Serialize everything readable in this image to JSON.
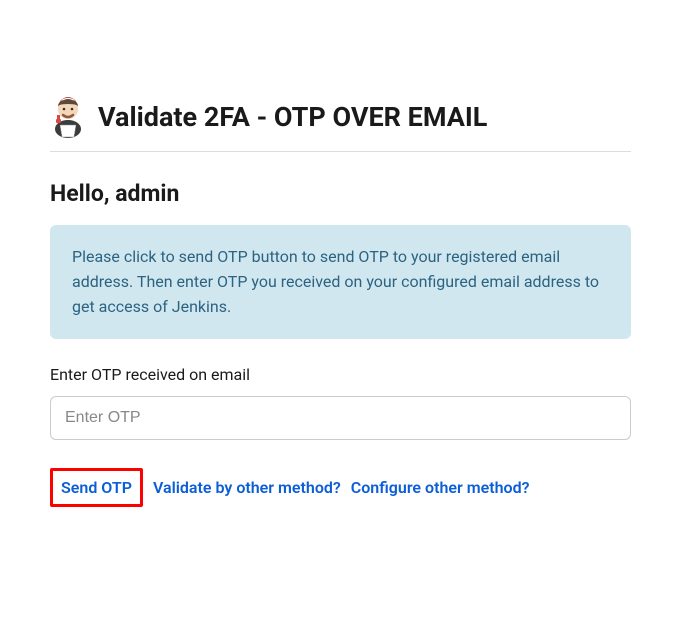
{
  "header": {
    "title": "Validate 2FA - OTP OVER EMAIL"
  },
  "greeting": "Hello, admin",
  "info_message": "Please click to send OTP button to send OTP to your registered email address. Then enter OTP you received on your configured email address to get access of Jenkins.",
  "form": {
    "otp_label": "Enter OTP received on email",
    "otp_placeholder": "Enter OTP"
  },
  "actions": {
    "send_otp": "Send OTP",
    "validate_other": "Validate by other method?",
    "configure_other": "Configure other method?"
  }
}
